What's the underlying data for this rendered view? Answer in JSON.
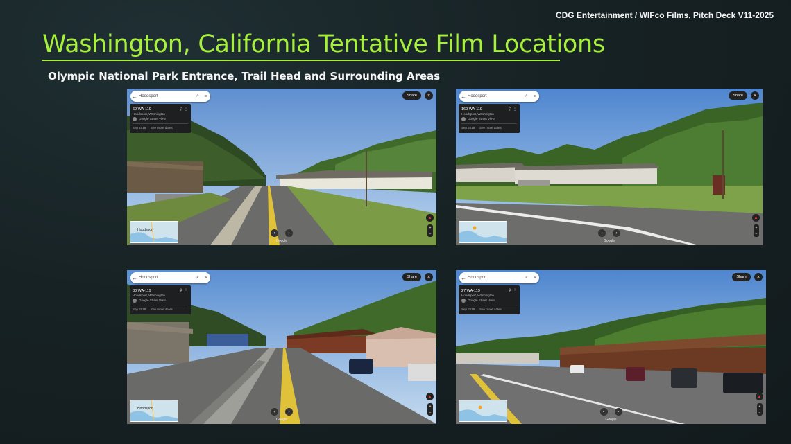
{
  "header": {
    "credit": "CDG Entertainment / WIFco Films, Pitch Deck V11-2025",
    "title": "Washington, California Tentative Film Locations",
    "subtitle": "Olympic National Park Entrance, Trail Head and Surrounding Areas"
  },
  "colors": {
    "accent": "#a6ef3a",
    "background": "#172224"
  },
  "panels": [
    {
      "search_text": "Hoodsport",
      "card_title": "60 WA-119",
      "card_sub": "Hoodsport, Washington",
      "card_source": "Google Street View",
      "card_date": "Sep 2018",
      "card_more": "See more dates",
      "share_label": "Share",
      "map_label": "Hoodsport",
      "google_mark": "Google"
    },
    {
      "search_text": "Hoodsport",
      "card_title": "160 WA-119",
      "card_sub": "Hoodsport, Washington",
      "card_source": "Google Street View",
      "card_date": "Sep 2018",
      "card_more": "See more dates",
      "share_label": "Share",
      "map_label": "",
      "google_mark": "Google"
    },
    {
      "search_text": "Hoodsport",
      "card_title": "30 WA-119",
      "card_sub": "Hoodsport, Washington",
      "card_source": "Google Street View",
      "card_date": "Sep 2018",
      "card_more": "See more dates",
      "share_label": "Share",
      "map_label": "Hoodsport",
      "google_mark": "Google"
    },
    {
      "search_text": "Hoodsport",
      "card_title": "27 WA-119",
      "card_sub": "Hoodsport, Washington",
      "card_source": "Google Street View",
      "card_date": "Sep 2018",
      "card_more": "See more dates",
      "share_label": "Share",
      "map_label": "",
      "google_mark": "Google"
    }
  ],
  "icons": {
    "back": "←",
    "search": "⌕",
    "close": "×",
    "pin": "⚲",
    "kebab": "⋮",
    "left": "‹",
    "right": "›",
    "compass": "▲",
    "zoom_in": "+",
    "zoom_out": "−"
  }
}
